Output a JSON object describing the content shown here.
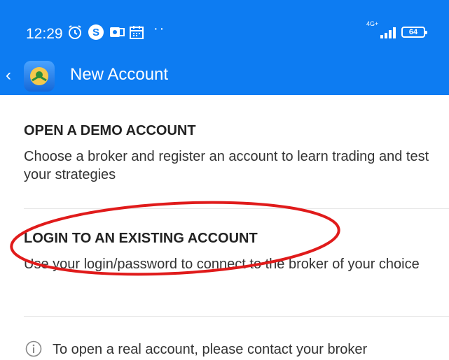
{
  "status_bar": {
    "time": "12:29",
    "network": "4G+",
    "battery": "64"
  },
  "app_bar": {
    "title": "New Account"
  },
  "options": [
    {
      "heading": "OPEN A DEMO ACCOUNT",
      "description": "Choose a broker and register an account to learn trading and test your strategies"
    },
    {
      "heading": "LOGIN TO AN EXISTING ACCOUNT",
      "description": "Use your login/password to connect to the broker of your choice"
    }
  ],
  "info": {
    "text": "To open a real account, please contact your broker"
  },
  "colors": {
    "app_bar": "#0d7cf2",
    "annotation": "#e01b1b"
  }
}
